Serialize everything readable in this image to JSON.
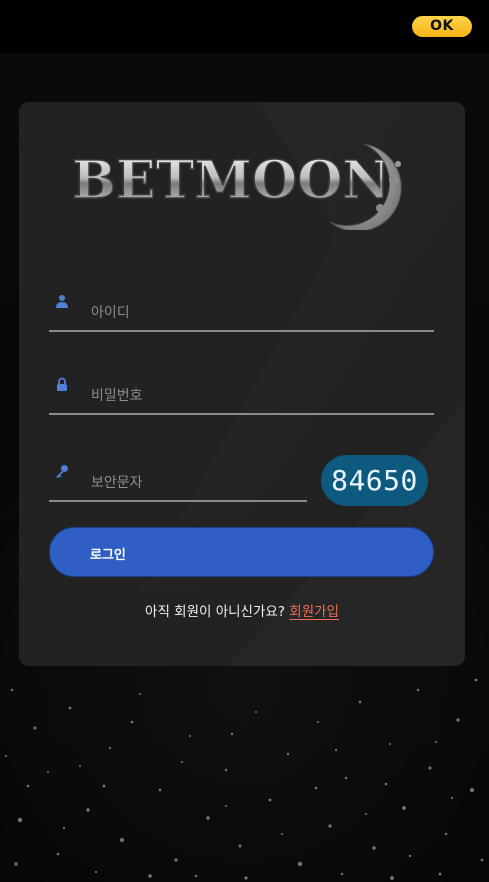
{
  "header": {
    "ok_label": "OK"
  },
  "brand": {
    "logo_text": "BETMOON"
  },
  "login_form": {
    "username_placeholder": "아이디",
    "password_placeholder": "비밀번호",
    "captcha_placeholder": "보안문자",
    "captcha_code": "84650",
    "login_label": "로그인",
    "signup_prompt": "아직 회원이 아니신가요? ",
    "signup_link": "회원가입"
  },
  "icons": {
    "username": "user-icon",
    "password": "lock-icon",
    "captcha": "key-icon"
  },
  "colors": {
    "accent_blue": "#2f5ec5",
    "ok_yellow": "#f7c128",
    "captcha_bg": "#0e5a7e",
    "link_orange": "#ef6d55",
    "card_bg": "#222222"
  }
}
